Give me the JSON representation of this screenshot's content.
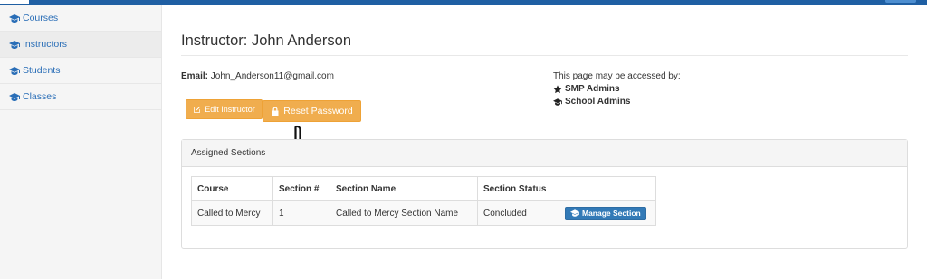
{
  "sidebar": {
    "items": [
      {
        "label": "Courses",
        "icon": "graduation-cap-icon"
      },
      {
        "label": "Instructors",
        "icon": "graduation-cap-icon"
      },
      {
        "label": "Students",
        "icon": "graduation-cap-icon"
      },
      {
        "label": "Classes",
        "icon": "graduation-cap-icon"
      }
    ]
  },
  "page": {
    "title": "Instructor: John Anderson",
    "email_label": "Email:",
    "email_value": "John_Anderson11@gmail.com"
  },
  "access": {
    "heading": "This page may be accessed by:",
    "roles": [
      {
        "label": "SMP Admins",
        "icon": "star-icon"
      },
      {
        "label": "School Admins",
        "icon": "graduation-cap-icon"
      }
    ]
  },
  "actions": {
    "edit_label": "Edit Instructor",
    "reset_label": "Reset Password"
  },
  "sections_panel": {
    "heading": "Assigned Sections",
    "columns": [
      "Course",
      "Section #",
      "Section Name",
      "Section Status",
      ""
    ],
    "rows": [
      {
        "course": "Called to Mercy",
        "section_num": "1",
        "section_name": "Called to Mercy Section Name",
        "status": "Concluded",
        "action_label": "Manage Section"
      }
    ]
  },
  "colors": {
    "primary": "#337ab7",
    "warning": "#f0ad4e",
    "topbar": "#1f5fa3",
    "link": "#2a6eb7"
  }
}
